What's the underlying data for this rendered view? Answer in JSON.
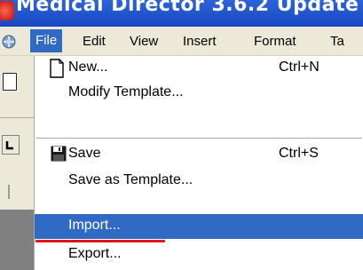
{
  "window": {
    "title": "Medical Director 3.6.2 Update",
    "icon": "app-logo-icon"
  },
  "menubar": {
    "app_icon": "app-menu-icon",
    "items": [
      {
        "label": "File",
        "active": true
      },
      {
        "label": "Edit"
      },
      {
        "label": "View"
      },
      {
        "label": "Insert"
      },
      {
        "label": "Format"
      },
      {
        "label": "Ta"
      }
    ]
  },
  "file_menu": {
    "items": [
      {
        "label": "New...",
        "shortcut": "Ctrl+N",
        "icon": "new-document-icon"
      },
      {
        "label": "Modify Template...",
        "shortcut": ""
      },
      {
        "label": "Save",
        "shortcut": "Ctrl+S",
        "icon": "save-disk-icon"
      },
      {
        "label": "Save as Template...",
        "shortcut": ""
      },
      {
        "label": "Import...",
        "shortcut": "",
        "highlighted": true
      },
      {
        "label": "Export...",
        "shortcut": ""
      }
    ]
  },
  "colors": {
    "highlight": "#316ac5",
    "menu_bg": "#ece9d8",
    "title_bar": "#1f55cd",
    "annotation_red": "#e0161b"
  }
}
